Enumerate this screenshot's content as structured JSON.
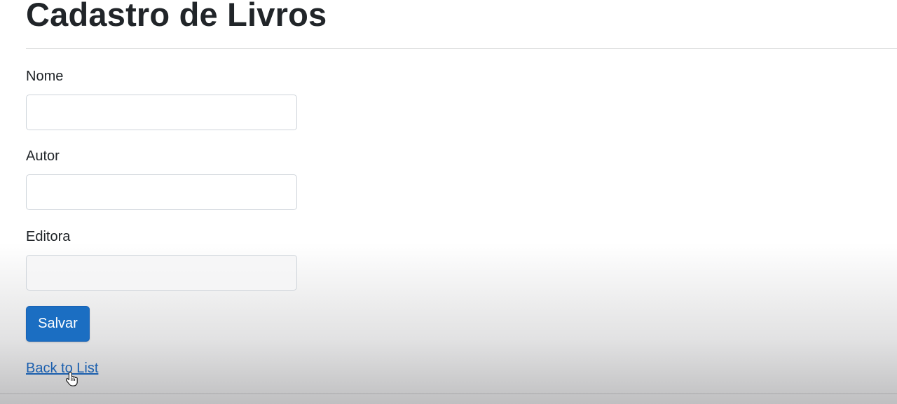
{
  "page": {
    "title": "Cadastro de Livros"
  },
  "form": {
    "fields": [
      {
        "label": "Nome",
        "value": "",
        "placeholder": ""
      },
      {
        "label": "Autor",
        "value": "",
        "placeholder": ""
      },
      {
        "label": "Editora",
        "value": "",
        "placeholder": ""
      }
    ],
    "submit_label": "Salvar"
  },
  "links": {
    "back_to_list": "Back to List"
  },
  "colors": {
    "primary_button": "#1b6ec2",
    "link": "#1b5fae",
    "text": "#212529",
    "input_border": "#ced4da"
  },
  "icons": {
    "cursor": "hand-pointer-icon"
  }
}
